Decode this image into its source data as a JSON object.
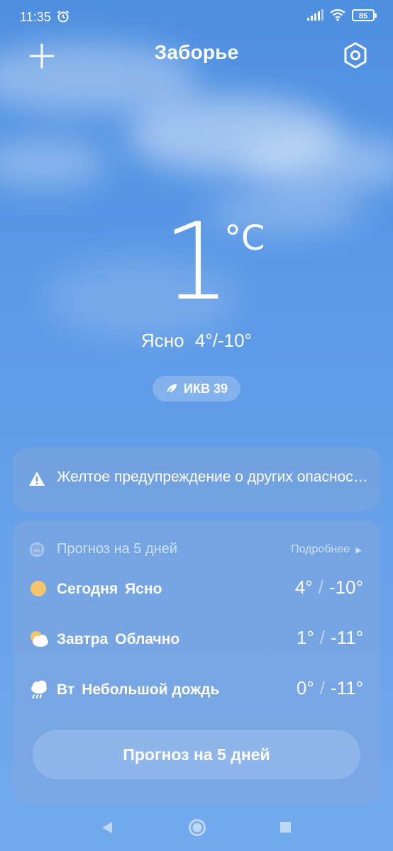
{
  "status_bar": {
    "time": "11:35",
    "battery": "85"
  },
  "header": {
    "city": "Заборье"
  },
  "current": {
    "temperature": "1",
    "unit": "°C",
    "condition": "Ясно",
    "high": "4°",
    "low": "-10°",
    "aqi_label": "ИКВ 39"
  },
  "warning": {
    "text": "Желтое предупреждение о других опасностях"
  },
  "forecast": {
    "title": "Прогноз на 5 дней",
    "more_label": "Подробнее",
    "days": [
      {
        "day": "Сегодня",
        "condition": "Ясно",
        "high": "4°",
        "low": "-10°",
        "icon": "sun-icon"
      },
      {
        "day": "Завтра",
        "condition": "Облачно",
        "high": "1°",
        "low": "-11°",
        "icon": "cloudy-icon"
      },
      {
        "day": "Вт",
        "condition": "Небольшой дождь",
        "high": "0°",
        "low": "-11°",
        "icon": "light-rain-icon"
      }
    ],
    "button_label": "Прогноз на 5 дней"
  },
  "colors": {
    "sky_top": "#4f8fe0",
    "sky_bottom": "#73a9ee",
    "sun": "#f6c46a",
    "warning_icon": "#ffffff"
  }
}
